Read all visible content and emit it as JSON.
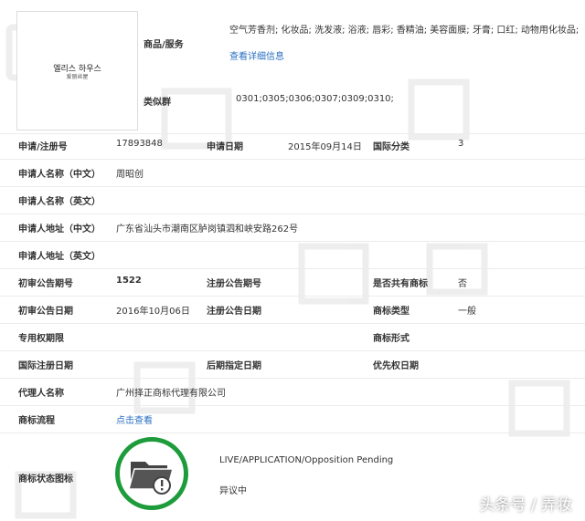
{
  "logo": {
    "line1": "엘리스 하우스",
    "line2": "爱丽丝屋"
  },
  "goods": {
    "label": "商品/服务",
    "value": "空气芳香剂; 化妆品; 洗发液; 浴液; 唇彩; 香精油; 美容面膜; 牙膏; 口红; 动物用化妆品;",
    "link": "查看详细信息"
  },
  "similar_group": {
    "label": "类似群",
    "value": "0301;0305;0306;0307;0309;0310;"
  },
  "reg_no": {
    "label": "申请/注册号",
    "value": "17893848"
  },
  "apply_date": {
    "label": "申请日期",
    "value": "2015年09月14日"
  },
  "intl_class": {
    "label": "国际分类",
    "value": "3"
  },
  "applicant_cn": {
    "label": "申请人名称（中文）",
    "value": "周昭创"
  },
  "applicant_en": {
    "label": "申请人名称（英文）",
    "value": ""
  },
  "address_cn": {
    "label": "申请人地址（中文）",
    "value": "广东省汕头市潮南区胪岗镇泗和峡安路262号"
  },
  "address_en": {
    "label": "申请人地址（英文）",
    "value": ""
  },
  "prelim_no": {
    "label": "初审公告期号",
    "value": "1522"
  },
  "reg_notice_no": {
    "label": "注册公告期号",
    "value": ""
  },
  "shared": {
    "label": "是否共有商标",
    "value": "否"
  },
  "prelim_date": {
    "label": "初审公告日期",
    "value": "2016年10月06日"
  },
  "reg_notice_date": {
    "label": "注册公告日期",
    "value": ""
  },
  "tm_type": {
    "label": "商标类型",
    "value": "一般"
  },
  "exclusive_period": {
    "label": "专用权期限",
    "value": ""
  },
  "tm_form": {
    "label": "商标形式",
    "value": ""
  },
  "intl_reg_date": {
    "label": "国际注册日期",
    "value": ""
  },
  "later_date": {
    "label": "后期指定日期",
    "value": ""
  },
  "priority_date": {
    "label": "优先权日期",
    "value": ""
  },
  "agent": {
    "label": "代理人名称",
    "value": "广州择正商标代理有限公司"
  },
  "flow": {
    "label": "商标流程",
    "link": "点击查看"
  },
  "status": {
    "label": "商标状态图标",
    "en": "LIVE/APPLICATION/Opposition Pending",
    "cn": "异议中"
  },
  "footer": {
    "text": "头条号 / 弄妆"
  },
  "colors": {
    "link": "#2a6fc2",
    "status_green": "#1e9c3c",
    "watermark": "#e6e6e6"
  },
  "icons": [
    "folder-alert-icon"
  ]
}
